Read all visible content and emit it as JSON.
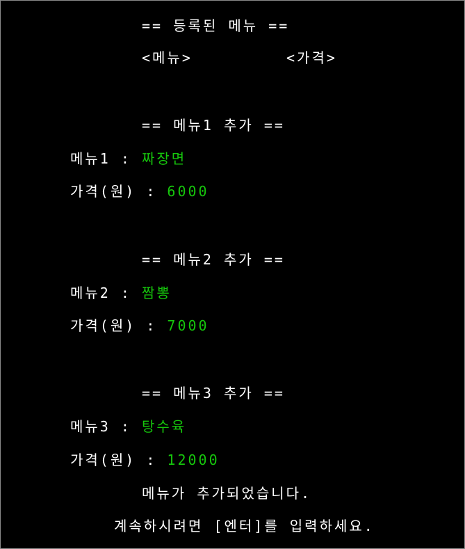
{
  "console": {
    "registered_header": "== 등록된 메뉴 ==",
    "col_menu": "<메뉴>",
    "col_price": "<가격>",
    "entries": [
      {
        "header": "== 메뉴1 추가 ==",
        "menu_label": "메뉴1 : ",
        "menu_value": "짜장면",
        "price_label": "가격(원) : ",
        "price_value": "6000"
      },
      {
        "header": "== 메뉴2 추가 ==",
        "menu_label": "메뉴2 : ",
        "menu_value": "짬뽕",
        "price_label": "가격(원) : ",
        "price_value": "7000"
      },
      {
        "header": "== 메뉴3 추가 ==",
        "menu_label": "메뉴3 : ",
        "menu_value": "탕수육",
        "price_label": "가격(원) : ",
        "price_value": "12000"
      }
    ],
    "added_message": "메뉴가 추가되었습니다.",
    "continue_prompt": "계속하시려면 [엔터]를 입력하세요."
  },
  "colors": {
    "background": "#000000",
    "text": "#ffffff",
    "input": "#16c60c"
  }
}
